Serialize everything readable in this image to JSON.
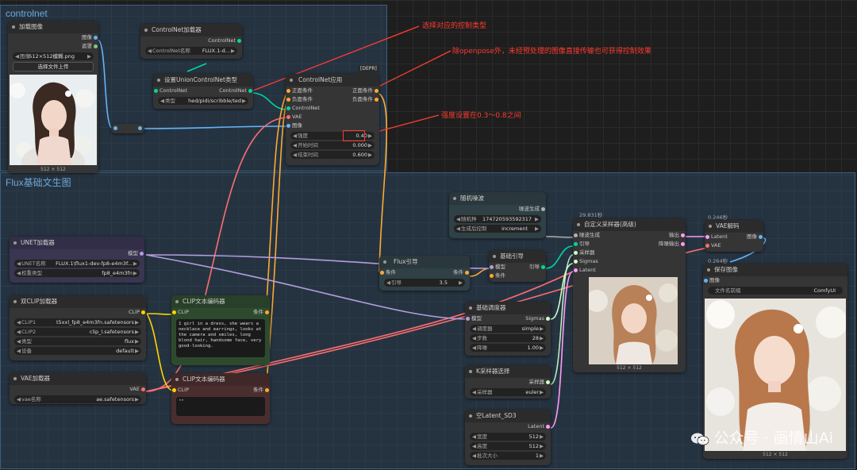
{
  "groups": {
    "controlnet": "controlnet",
    "flux": "Flux基础文生图"
  },
  "annotations": {
    "a1": "选择对应的控制类型",
    "a2": "除openpose外，未经预处理的图像直接传输也可获得控制效果",
    "a3": "强度设置在0.3～0.8之间"
  },
  "load_image": {
    "title": "加载图像",
    "out_image": "图像",
    "out_mask": "遮罩",
    "image_label": "图像",
    "image_value": "512×512模糊.png",
    "upload": "选择文件上传",
    "size": "512 × 512"
  },
  "cn_loader": {
    "title": "ControlNet加载器",
    "out": "ControlNet",
    "name_label": "ControlNet名称",
    "name_value": "FLUX.1-d..."
  },
  "union_type": {
    "title": "设置UnionControlNet类型",
    "in": "ControlNet",
    "out": "ControlNet",
    "type_label": "类型",
    "type_value": "hed/pidi/scribble/ted"
  },
  "cn_apply": {
    "title": "ControlNet应用",
    "badge": "[DEPR]",
    "in_pos": "正面条件",
    "in_neg": "负面条件",
    "in_cn": "ControlNet",
    "in_vae": "VAE",
    "in_img": "图像",
    "out_pos": "正面条件",
    "out_neg": "负面条件",
    "w1_label": "强度",
    "w1_value": "0.40",
    "w2_label": "开始时间",
    "w2_value": "0.000",
    "w3_label": "结束时间",
    "w3_value": "0.600"
  },
  "noise": {
    "title": "随机噪波",
    "out": "噪波生成",
    "seed_label": "随机种",
    "seed_value": "174720593592317",
    "ctrl_label": "生成后控制",
    "ctrl_value": "increment"
  },
  "unet": {
    "title": "UNET加载器",
    "out": "模型",
    "name_label": "UNET名称",
    "name_value": "FLUX.1\\flux1-dev-fp8-e4m3f...",
    "dtype_label": "权重类型",
    "dtype_value": "fp8_e4m3fn"
  },
  "flux_guide": {
    "title": "Flux引导",
    "in": "条件",
    "out": "条件",
    "g_label": "引导",
    "g_value": "3.5"
  },
  "basic_guider": {
    "title": "基础引导",
    "in_model": "模型",
    "in_cond": "条件",
    "out": "引导"
  },
  "sampler_adv": {
    "title": "自定义采样器(高级)",
    "timing": "29.831秒",
    "in_noise": "噪波生成",
    "in_guider": "引导",
    "in_sampler": "采样器",
    "in_sigmas": "Sigmas",
    "in_latent": "Latent",
    "out1": "输出",
    "out2": "降噪输出",
    "size": "512 × 512"
  },
  "vae_decode": {
    "title": "VAE解码",
    "timing": "0.246秒",
    "in_latent": "Latent",
    "in_vae": "VAE",
    "out": "图像"
  },
  "save_image": {
    "title": "保存图像",
    "timing": "0.264秒",
    "in": "图像",
    "prefix_label": "文件名前缀",
    "prefix_value": "ComfyUI",
    "size": "512 × 512"
  },
  "dual_clip": {
    "title": "双CLIP加载器",
    "out": "CLIP",
    "c1_label": "CLIP1",
    "c1_value": "t5xxl_fp8_e4m3fn.safetensors",
    "c2_label": "CLIP2",
    "c2_value": "clip_l.safetensors",
    "type_label": "类型",
    "type_value": "flux",
    "dev_label": "设备",
    "dev_value": "default"
  },
  "clip_pos": {
    "title": "CLIP文本编码器",
    "in": "CLIP",
    "out": "条件",
    "text": "1 girl in a dress, she wears a necklace and earrings, looks at the camera and smiles, long blond hair, handsome face, very good-looking."
  },
  "basic_sched": {
    "title": "基础调度器",
    "in": "模型",
    "out": "Sigmas",
    "s_label": "调度器",
    "s_value": "simple",
    "steps_label": "步数",
    "steps_value": "28",
    "den_label": "降噪",
    "den_value": "1.00"
  },
  "vae_loader": {
    "title": "VAE加载器",
    "out": "VAE",
    "name_label": "vae名称",
    "name_value": "ae.safetensors"
  },
  "clip_neg": {
    "title": "CLIP文本编码器",
    "in": "CLIP",
    "out": "条件",
    "text": "\"\""
  },
  "ksampler_sel": {
    "title": "K采样器选择",
    "out": "采样器",
    "s_label": "采样器",
    "s_value": "euler"
  },
  "empty_latent": {
    "title": "空Latent_SD3",
    "out": "Latent",
    "w_label": "宽度",
    "w_value": "512",
    "h_label": "高度",
    "h_value": "512",
    "b_label": "批次大小",
    "b_value": "1"
  },
  "watermark": "公众号 · 画情山Ai",
  "colors": {
    "image": "#64b5f6",
    "mask": "#81c784",
    "controlnet": "#00d6a0",
    "conditioning": "#ffa931",
    "vae": "#ff6e6e",
    "model": "#b39ddb",
    "clip": "#ffd500",
    "latent": "#ff9cf9",
    "noise": "#b0b0b0",
    "sigmas": "#cdffcd",
    "annotation": "#ff3b30"
  }
}
